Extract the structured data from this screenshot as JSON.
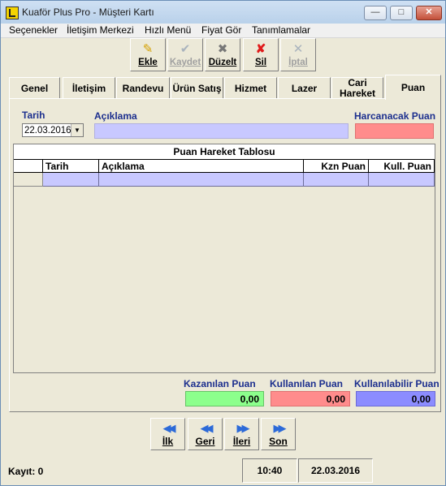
{
  "window": {
    "title": "Kuaför Plus Pro - Müşteri Kartı"
  },
  "menu": [
    "Seçenekler",
    "İletişim Merkezi",
    "Hızlı Menü",
    "Fiyat Gör",
    "Tanımlamalar"
  ],
  "toolbar": {
    "add": "Ekle",
    "save": "Kaydet",
    "edit": "Düzelt",
    "delete": "Sil",
    "cancel": "İptal"
  },
  "tabs": [
    "Genel",
    "İletişim",
    "Randevu",
    "Ürün Satış",
    "Hizmet",
    "Lazer",
    "Cari Hareket",
    "Puan"
  ],
  "active_tab": "Puan",
  "form": {
    "date_label": "Tarih",
    "date_value": "22.03.2016",
    "desc_label": "Açıklama",
    "points_label": "Harcanacak Puan"
  },
  "table": {
    "title": "Puan Hareket Tablosu",
    "columns": [
      "Tarih",
      "Açıklama",
      "Kzn Puan",
      "Kull. Puan"
    ]
  },
  "summary": {
    "earned_label": "Kazanılan Puan",
    "earned_value": "0,00",
    "used_label": "Kullanılan Puan",
    "used_value": "0,00",
    "available_label": "Kullanılabilir Puan",
    "available_value": "0,00"
  },
  "nav": {
    "first": "İlk",
    "prev": "Geri",
    "next": "İleri",
    "last": "Son"
  },
  "status": {
    "record": "Kayıt: 0",
    "time": "10:40",
    "date": "22.03.2016"
  },
  "colors": {
    "blue_field": "#c8c8ff",
    "red_field": "#ff8c8c",
    "green_field": "#8cff8c",
    "label_blue": "#1c2f8e"
  }
}
